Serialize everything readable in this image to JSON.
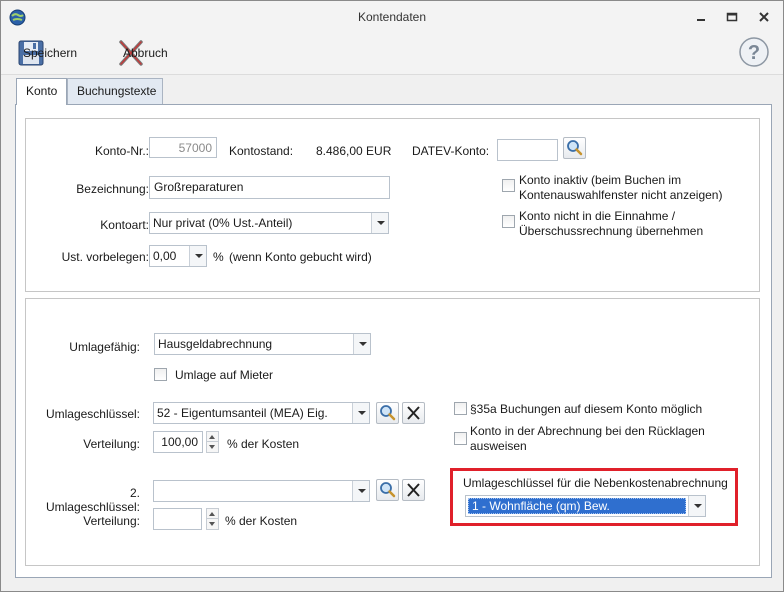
{
  "window": {
    "title": "Kontendaten"
  },
  "toolbar": {
    "save_label": "Speichern",
    "cancel_label": "Abbruch"
  },
  "tabs": [
    {
      "label": "Konto"
    },
    {
      "label": "Buchungstexte"
    }
  ],
  "account": {
    "number_label": "Konto-Nr.:",
    "number_value": "57000",
    "balance_label": "Kontostand:",
    "balance_value": "8.486,00 EUR",
    "datev_label": "DATEV-Konto:",
    "datev_value": "",
    "name_label": "Bezeichnung:",
    "name_value": "Großreparaturen",
    "type_label": "Kontoart:",
    "type_value": "Nur privat (0% Ust.-Anteil)",
    "vat_label": "Ust. vorbelegen:",
    "vat_value": "0,00",
    "vat_unit": "%",
    "vat_hint": "(wenn Konto gebucht wird)",
    "inactive_label_line1": "Konto inaktiv (beim Buchen im",
    "inactive_label_line2": "Kontenauswahlfenster nicht anzeigen)",
    "exclude_label_line1": "Konto nicht in die Einnahme /",
    "exclude_label_line2": "Überschussrechnung übernehmen"
  },
  "allocation": {
    "allocatable_label": "Umlagefähig:",
    "allocatable_value": "Hausgeldabrechnung",
    "tenant_label": "Umlage auf Mieter",
    "key_label": "Umlageschlüssel:",
    "key_value": "52 - Eigentumsanteil (MEA) Eig.",
    "distribution_label": "Verteilung:",
    "distribution_value": "100,00",
    "distribution_unit": "% der Kosten",
    "key2_label": "2. Umlageschlüssel:",
    "key2_value": "",
    "distribution2_label": "Verteilung:",
    "distribution2_value": "",
    "distribution2_unit": "% der Kosten",
    "s35a_label": "§35a Buchungen auf diesem Konto möglich",
    "reserve_label_line1": "Konto in der Abrechnung bei den Rücklagen",
    "reserve_label_line2": "ausweisen",
    "ancillary_key_label": "Umlageschlüssel für die Nebenkostenabrechnung",
    "ancillary_key_value": "1 - Wohnfläche (qm) Bew."
  },
  "colors": {
    "highlight": "#e0202a",
    "selection": "#2f6fcf"
  }
}
